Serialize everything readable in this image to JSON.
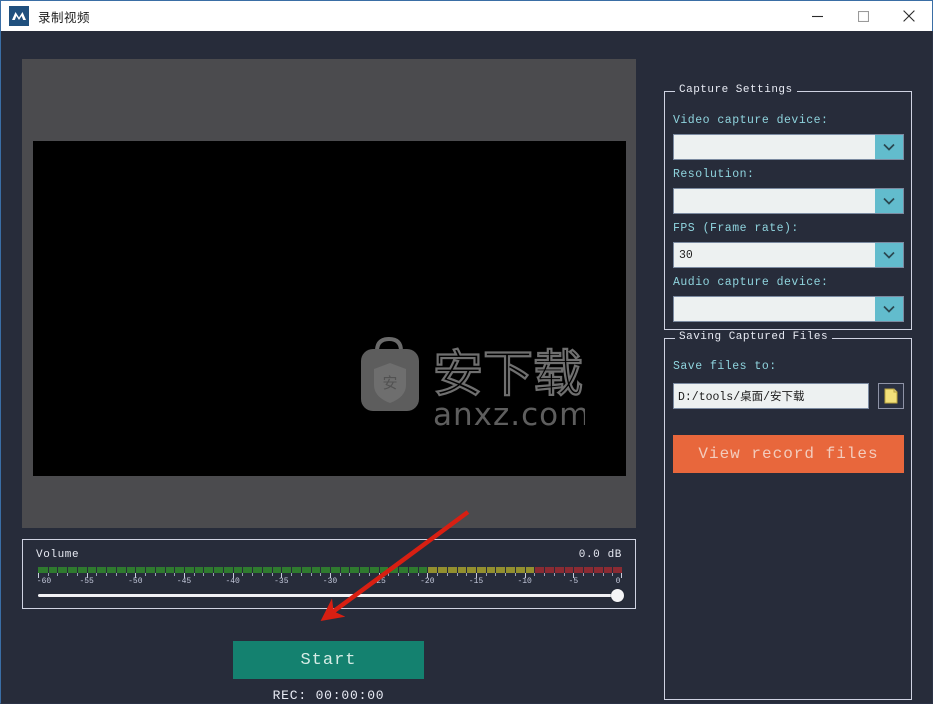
{
  "window": {
    "title": "录制视频",
    "icon": "app-logo-icon",
    "controls": {
      "minimize": "minimize-icon",
      "maximize": "maximize-icon",
      "close": "close-icon"
    }
  },
  "preview": {
    "watermark": {
      "brand_cn": "安下载",
      "domain": "anxz.com",
      "bag_glyph": "安"
    }
  },
  "volume": {
    "label": "Volume",
    "db_readout": "0.0 dB",
    "scale": {
      "min": -60,
      "max": 0,
      "major_ticks": [
        -60,
        -55,
        -50,
        -45,
        -40,
        -35,
        -30,
        -25,
        -20,
        -15,
        -10,
        -5,
        0
      ],
      "tick_labels": [
        "-60",
        "-55",
        "-50",
        "-45",
        "-40",
        "-35",
        "-30",
        "-25",
        "-20",
        "-15",
        "-10",
        "-5",
        "0"
      ],
      "segments": [
        {
          "name": "green",
          "from": -60,
          "to": -20,
          "color": "#2f7a2f"
        },
        {
          "name": "yellow",
          "from": -20,
          "to": -9,
          "color": "#93902f"
        },
        {
          "name": "red",
          "from": -9,
          "to": 0,
          "color": "#8a2b33"
        }
      ]
    },
    "slider_value_percent": 100
  },
  "transport": {
    "start_label": "Start",
    "rec_label": "REC: 00:00:00"
  },
  "capture_settings": {
    "group_title": "Capture Settings",
    "fields": [
      {
        "label": "Video capture device:",
        "value": "",
        "name": "video-capture-device"
      },
      {
        "label": "Resolution:",
        "value": "",
        "name": "resolution"
      },
      {
        "label": "FPS (Frame rate):",
        "value": "30",
        "name": "fps"
      },
      {
        "label": "Audio capture device:",
        "value": "",
        "name": "audio-capture-device"
      }
    ]
  },
  "saving": {
    "group_title": "Saving Captured Files",
    "path_label": "Save files to:",
    "path_value": "D:/tools/桌面/安下载",
    "browse_icon": "folder-icon",
    "view_files_label": "View record files"
  },
  "colors": {
    "window_bg": "#272c3a",
    "panel_gray": "#4b4b4e",
    "accent_teal": "#62bccd",
    "label_teal": "#8fd4de",
    "start_green": "#14816f",
    "orange_button": "#e8673c",
    "annotation_red": "#d81f12"
  }
}
